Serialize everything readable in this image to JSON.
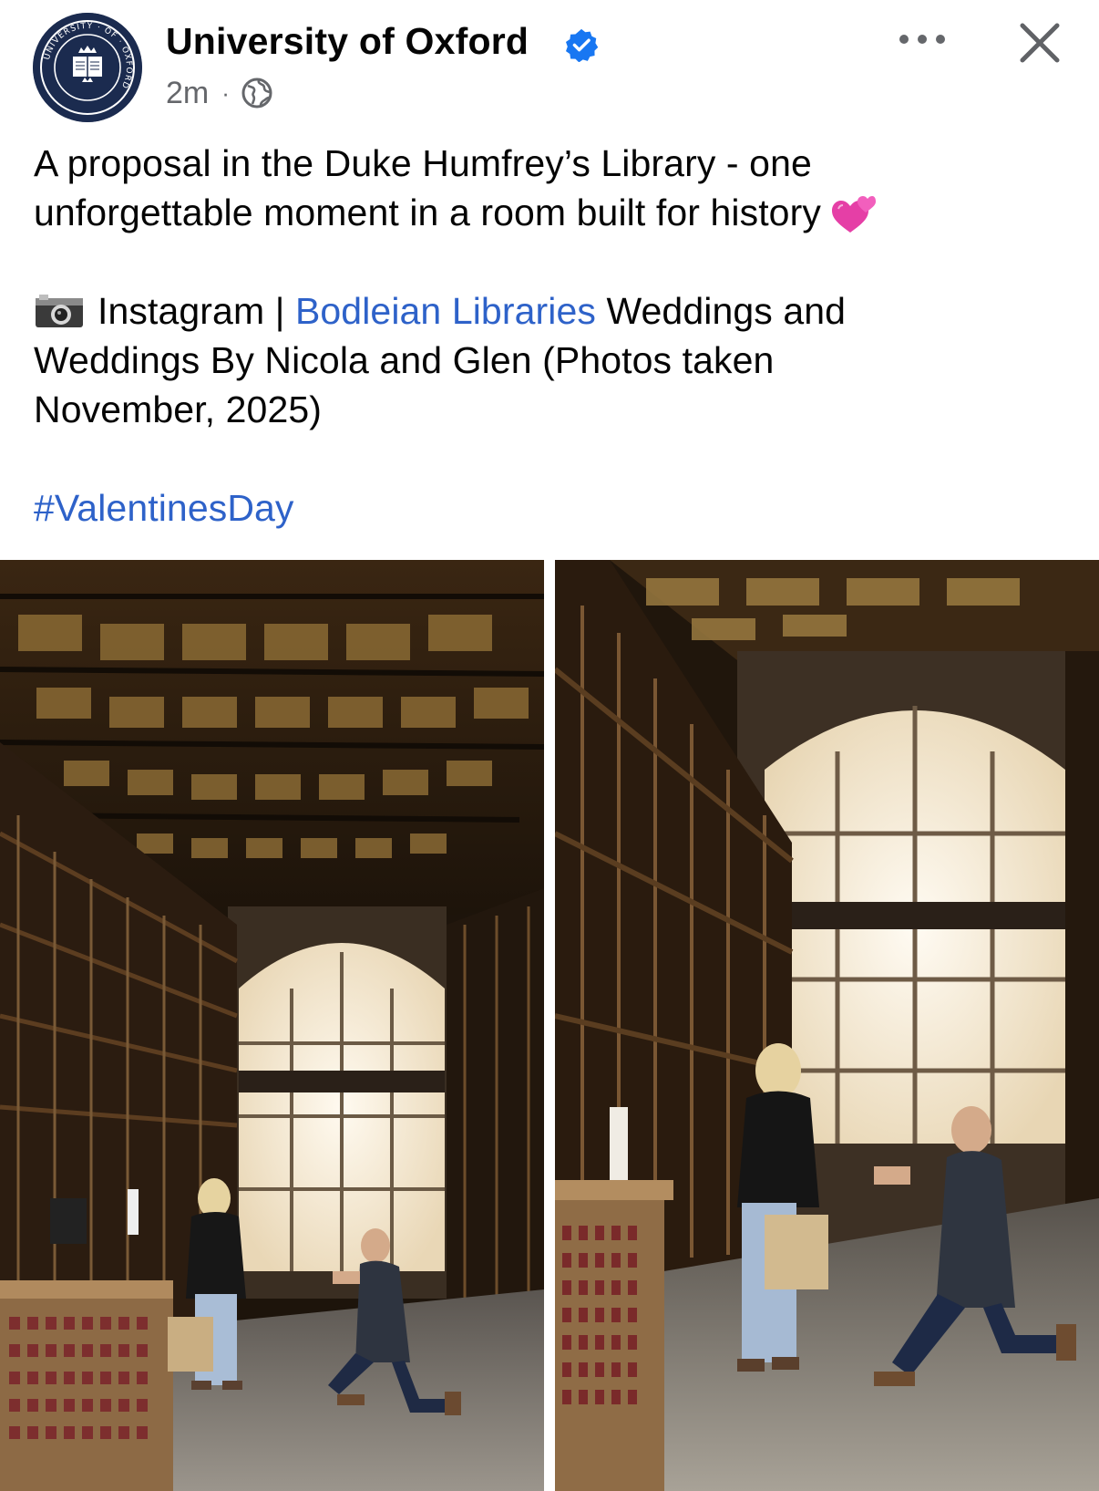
{
  "post": {
    "author": "University of Oxford",
    "time": "2m",
    "line1": "A proposal in the Duke Humfrey’s Library - one",
    "line2": "unforgettable moment in a room built for history",
    "credit_prefix": "Instagram |",
    "credit_link": "Bodleian Libraries",
    "credit_rest_1": "Weddings and",
    "credit_line2": "Weddings By Nicola and Glen (Photos taken",
    "credit_line3": "November, 2025)",
    "hashtag": "#ValentinesDay"
  },
  "logo_text": {
    "ring": "UNIVERSITY · OF · OXFORD"
  },
  "colors": {
    "link": "#2e62c9",
    "verified": "#1877f2",
    "logo_background": "#1b2b4f",
    "secondary_text": "#65676b"
  },
  "icons": {
    "verified": "verified-badge-icon",
    "privacy": "globe-icon",
    "more": "more-options-icon",
    "close": "close-icon",
    "camera": "camera-emoji",
    "hearts": "two-hearts-emoji"
  },
  "photos": [
    {
      "description_id": "proposal-photo-wide"
    },
    {
      "description_id": "proposal-photo-close"
    }
  ]
}
